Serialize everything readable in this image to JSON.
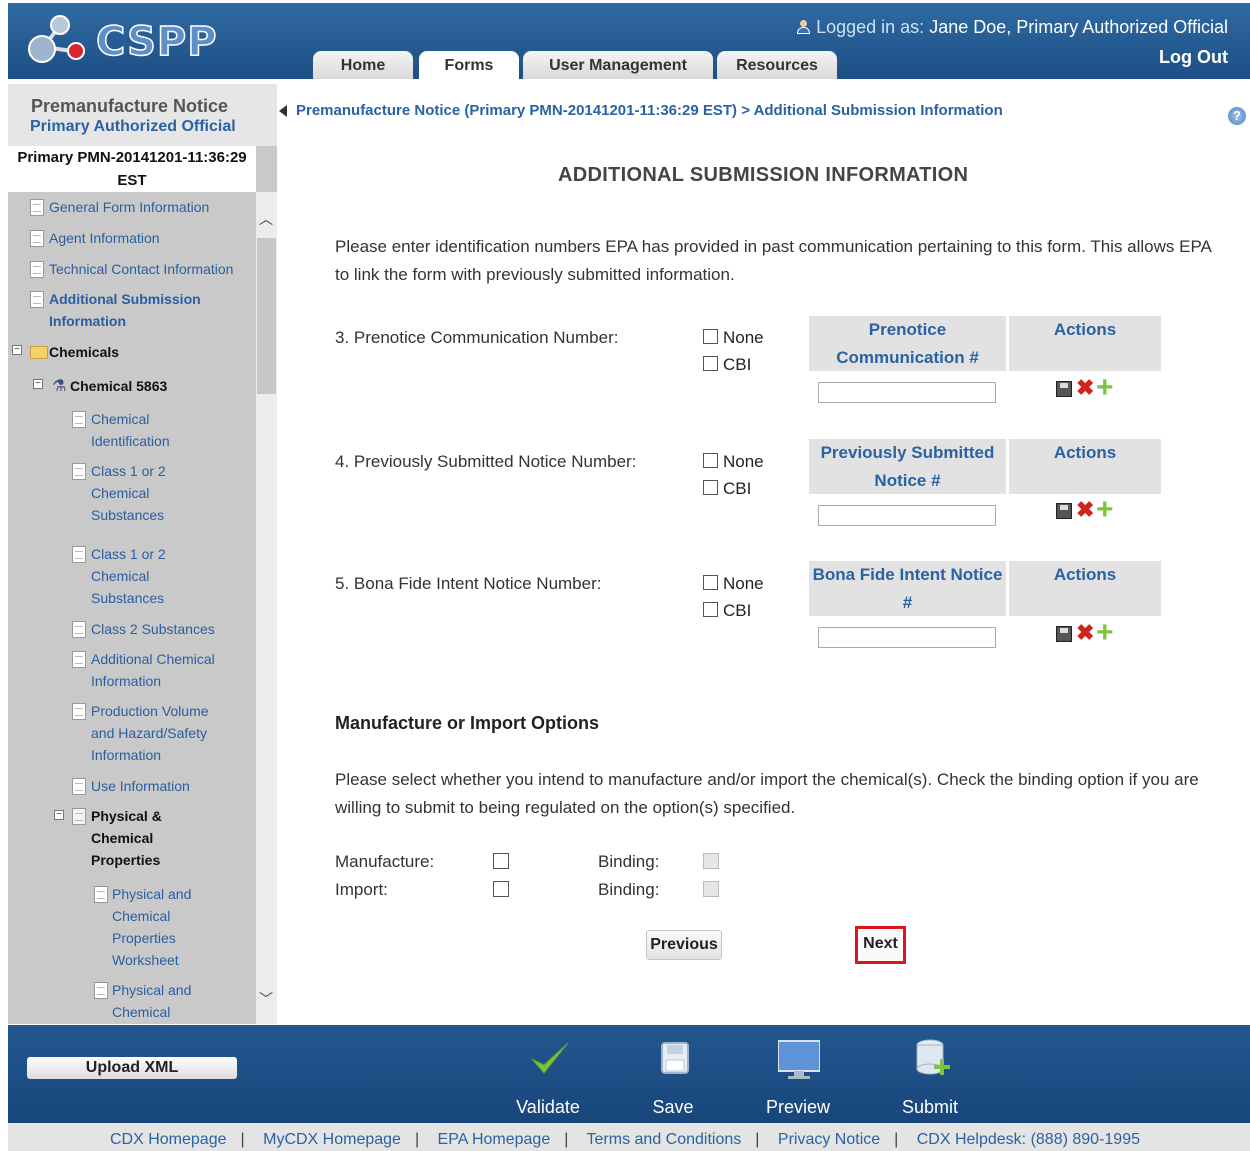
{
  "header": {
    "logo_text": "CSPP",
    "login_prefix": "Logged in as:",
    "user": "Jane Doe, Primary Authorized Official",
    "logout": "Log Out",
    "tabs": [
      {
        "label": "Home"
      },
      {
        "label": "Forms",
        "active": true
      },
      {
        "label": "User Management"
      },
      {
        "label": "Resources"
      }
    ]
  },
  "sidebar": {
    "title": "Premanufacture Notice",
    "subtitle": "Primary Authorized Official",
    "pmn_line1": "Primary PMN-20141201-11:36:29",
    "pmn_line2": "EST",
    "items": [
      {
        "label": "General Form Information"
      },
      {
        "label": "Agent Information"
      },
      {
        "label": "Technical Contact Information"
      },
      {
        "label": "Additional Submission Information"
      },
      {
        "label": "Chemicals"
      },
      {
        "label": "Chemical 5863"
      },
      {
        "label": "Chemical Identification"
      },
      {
        "label": "Class 1 or 2 Chemical Substances"
      },
      {
        "label": "Class 1 or 2 Chemical Substances"
      },
      {
        "label": "Class 2 Substances"
      },
      {
        "label": "Additional Chemical Information"
      },
      {
        "label": "Production Volume and Hazard/Safety Information"
      },
      {
        "label": "Use Information"
      },
      {
        "label": "Physical & Chemical Properties"
      },
      {
        "label": "Physical and Chemical Properties Worksheet"
      },
      {
        "label": "Physical and Chemical"
      }
    ]
  },
  "breadcrumb": "Premanufacture Notice (Primary PMN-20141201-11:36:29 EST) > Additional Submission Information",
  "main": {
    "title": "ADDITIONAL SUBMISSION INFORMATION",
    "intro": "Please enter identification numbers EPA has provided in past communication pertaining to this form. This allows EPA to link the form with previously submitted information.",
    "none_label": "None",
    "cbi_label": "CBI",
    "actions_header": "Actions",
    "questions": [
      {
        "label": "3. Prenotice Communication Number:",
        "col_header": "Prenotice Communication #",
        "value": ""
      },
      {
        "label": "4. Previously Submitted Notice Number:",
        "col_header": "Previously Submitted Notice #",
        "value": ""
      },
      {
        "label": "5. Bona Fide Intent Notice Number:",
        "col_header": "Bona Fide Intent Notice #",
        "value": ""
      }
    ],
    "options_title": "Manufacture or Import Options",
    "options_text": "Please select whether you intend to manufacture and/or import the chemical(s). Check the binding option if you are willing to submit to being regulated on the option(s) specified.",
    "manufacture_label": "Manufacture:",
    "import_label": "Import:",
    "binding_label": "Binding:",
    "previous_button": "Previous",
    "next_button": "Next"
  },
  "bottombar": {
    "upload_button": "Upload XML",
    "tools": [
      {
        "label": "Validate",
        "icon": "checkmark-icon"
      },
      {
        "label": "Save",
        "icon": "floppy-disk-icon"
      },
      {
        "label": "Preview",
        "icon": "monitor-icon"
      },
      {
        "label": "Submit",
        "icon": "database-add-icon"
      }
    ]
  },
  "footer": {
    "links": [
      "CDX Homepage",
      "MyCDX Homepage",
      "EPA Homepage",
      "Terms and Conditions",
      "Privacy Notice",
      "CDX Helpdesk: (888) 890-1995"
    ]
  },
  "colors": {
    "header_blue": "#1d4f85",
    "link_blue": "#2a62a4",
    "highlight_red": "#e0141b"
  }
}
